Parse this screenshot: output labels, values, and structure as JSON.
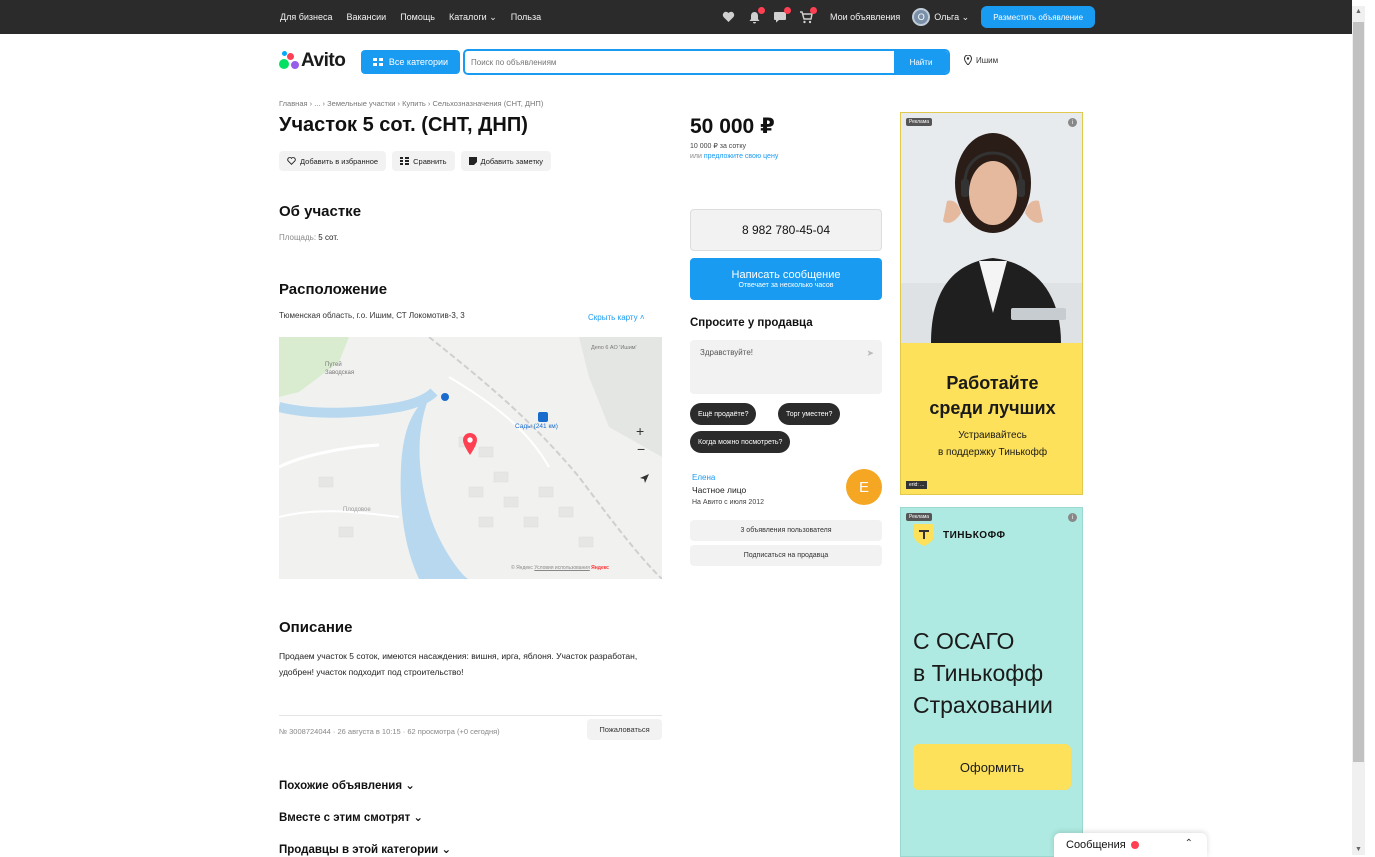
{
  "topbar": {
    "links": [
      "Для бизнеса",
      "Вакансии",
      "Помощь",
      "Каталоги ⌄",
      "Польза"
    ],
    "my_ads": "Мои объявления",
    "user_initial": "О",
    "user_name": "Ольга ⌄",
    "post_button": "Разместить объявление"
  },
  "header": {
    "logo_text": "Avito",
    "all_categories": "Все категории",
    "search_placeholder": "Поиск по объявлениям",
    "find_button": "Найти",
    "location": "Ишим"
  },
  "listing": {
    "breadcrumb": "Главная › ... › Земельные участки › Купить › Сельхозназначения (СНТ, ДНП)",
    "title": "Участок 5 сот. (СНТ, ДНП)",
    "actions": [
      "Добавить в избранное",
      "Сравнить",
      "Добавить заметку"
    ],
    "about_heading": "Об участке",
    "area_label": "Площадь:",
    "area_value": "5 сот.",
    "location_heading": "Расположение",
    "address": "Тюменская область, г.о. Ишим, СТ Локомотив-3, 3",
    "hide_map": "Скрыть карту ˄",
    "map_labels": {
      "street1": "Путей",
      "street2": "Заводская",
      "place": "Сады (241 км)",
      "district": "Плодовое",
      "depot": "Депо 6 АО 'Ишим'",
      "copyright": "© Яндекс",
      "terms": "Условия использования",
      "yandex": "Яндекс"
    },
    "description_heading": "Описание",
    "description": "Продаем участок 5 соток, имеются насаждения: вишня, ирга, яблоня. Участок разработан, удобрен! участок подходит под строительство!",
    "meta": "№ 3008724044 · 26 августа в 10:15 · 62 просмотра (+0 сегодня)",
    "report": "Пожаловаться",
    "collapsibles": [
      "Похожие объявления ⌄",
      "Вместе с этим смотрят ⌄",
      "Продавцы в этой категории ⌄"
    ]
  },
  "pricing": {
    "price": "50 000 ₽",
    "per_unit": "10 000 ₽ за сотку",
    "offer_prefix": "или ",
    "offer_link": "предложите свою цену",
    "phone": "8 982 780-45-04",
    "message_button": "Написать сообщение",
    "message_sub": "Отвечает за несколько часов",
    "ask_heading": "Спросите у продавца",
    "ask_text": "Здравствуйте!",
    "chips": [
      "Ещё продаёте?",
      "Торг уместен?",
      "Когда можно посмотреть?"
    ]
  },
  "seller": {
    "name": "Елена",
    "type": "Частное лицо",
    "since": "На Авито с июля 2012",
    "initial": "Е",
    "ads_button": "3 объявления пользователя",
    "subscribe_button": "Подписаться на продавца"
  },
  "ads": {
    "ad1_tag": "Реклама",
    "ad1_head_1": "Работайте",
    "ad1_head_2": "среди лучших",
    "ad1_sub_1": "Устраивайтесь",
    "ad1_sub_2": "в поддержку Тинькофф",
    "ad1_foot": "erid: ...",
    "ad2_tag": "Реклама",
    "ad2_brand": "ТИНЬКОФФ",
    "ad2_head_1": "С ОСАГО",
    "ad2_head_2": "в Тинькофф",
    "ad2_head_3": "Страховании",
    "ad2_cta": "Оформить"
  },
  "widget": {
    "messages": "Сообщения"
  },
  "colors": {
    "accent": "#1a9bf2",
    "topbar": "#2b2b2b",
    "ad_yellow": "#fde15a",
    "ad_mint": "#aeeae1",
    "badge": "#ff4053"
  }
}
